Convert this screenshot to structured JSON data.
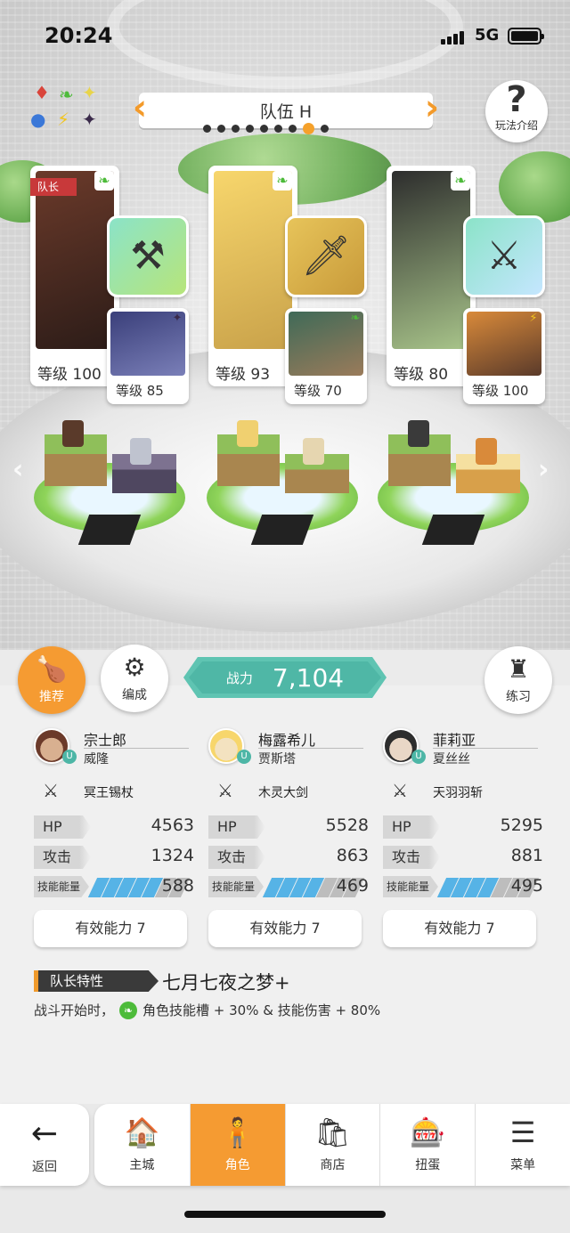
{
  "status_bar": {
    "time": "20:24",
    "network": "5G"
  },
  "team": {
    "title": "队伍 H",
    "page_count": 9,
    "active_page": 8
  },
  "help": {
    "label": "玩法介绍"
  },
  "leader_tag": "队长",
  "cards": [
    {
      "main": {
        "level": "等级 100",
        "element": "leaf",
        "colors": [
          "#6b3a2a",
          "#2c1c18"
        ]
      },
      "weapon": {
        "icon": "axe-icon",
        "glyph": "⚒",
        "colors": [
          "#8be3c8",
          "#b7e57a"
        ]
      },
      "sub": {
        "level": "等级 85",
        "element": "dark",
        "colors": [
          "#3a3f7a",
          "#7a7fb8"
        ]
      }
    },
    {
      "main": {
        "level": "等级 93",
        "element": "leaf",
        "colors": [
          "#f7d66c",
          "#c9a24a"
        ]
      },
      "weapon": {
        "icon": "wooden-sword-icon",
        "glyph": "🗡",
        "colors": [
          "#e7c45a",
          "#c89a3a"
        ]
      },
      "sub": {
        "level": "等级 70",
        "element": "leaf",
        "colors": [
          "#3f6a58",
          "#9a7b5a"
        ]
      }
    },
    {
      "main": {
        "level": "等级 80",
        "element": "leaf",
        "colors": [
          "#2d2d2d",
          "#a8c48a"
        ]
      },
      "weapon": {
        "icon": "blue-sword-icon",
        "glyph": "⚔",
        "colors": [
          "#8be3c8",
          "#c5e6ff"
        ]
      },
      "sub": {
        "level": "等级 100",
        "element": "light",
        "colors": [
          "#d98a3a",
          "#5a3a2a"
        ]
      }
    }
  ],
  "buttons": {
    "recommend": "推荐",
    "formation": "编成",
    "training": "练习"
  },
  "power": {
    "label": "战力",
    "value": "7,104"
  },
  "characters": [
    {
      "name": "宗士郎",
      "sub_name": "威隆",
      "weapon": "冥王锡杖",
      "hp_label": "HP",
      "hp": "4563",
      "atk_label": "攻击",
      "atk": "1324",
      "skill_label": "技能能量",
      "skill": "588",
      "skill_fill": 0.6,
      "effective": "有效能力 7",
      "avatar_colors": [
        "#6b3a2a",
        "#d8b090"
      ]
    },
    {
      "name": "梅露希儿",
      "sub_name": "贾斯塔",
      "weapon": "木灵大剑",
      "hp_label": "HP",
      "hp": "5528",
      "atk_label": "攻击",
      "atk": "863",
      "skill_label": "技能能量",
      "skill": "469",
      "skill_fill": 0.45,
      "effective": "有效能力 7",
      "avatar_colors": [
        "#f7d66c",
        "#f3e2c0"
      ]
    },
    {
      "name": "菲莉亚",
      "sub_name": "夏丝丝",
      "weapon": "天羽羽斩",
      "hp_label": "HP",
      "hp": "5295",
      "atk_label": "攻击",
      "atk": "881",
      "skill_label": "技能能量",
      "skill": "495",
      "skill_fill": 0.5,
      "effective": "有效能力 7",
      "avatar_colors": [
        "#2d2d2d",
        "#e9d7c6"
      ]
    }
  ],
  "leader": {
    "label": "队长特性",
    "name": "七月七夜之梦+",
    "desc_prefix": "战斗开始时，",
    "desc": "角色技能槽 + 30% & 技能伤害 + 80%"
  },
  "nav": {
    "back": "返回",
    "tabs": [
      {
        "label": "主城",
        "icon": "castle-icon",
        "glyph": "🏠"
      },
      {
        "label": "角色",
        "icon": "character-icon",
        "glyph": "🧍"
      },
      {
        "label": "商店",
        "icon": "shop-icon",
        "glyph": "🛍"
      },
      {
        "label": "扭蛋",
        "icon": "gacha-icon",
        "glyph": "🎰"
      },
      {
        "label": "菜单",
        "icon": "menu-icon",
        "glyph": "☰"
      }
    ],
    "active": 1
  }
}
